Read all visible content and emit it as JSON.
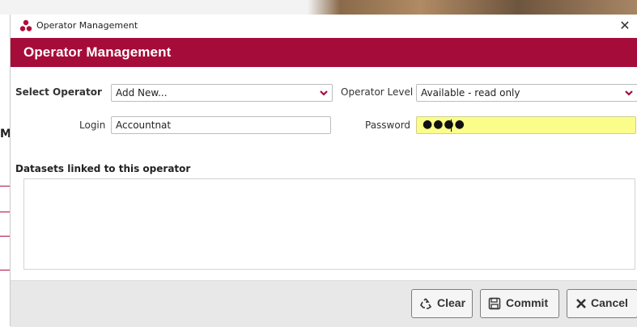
{
  "window": {
    "title": "Operator Management",
    "close_glyph": "✕"
  },
  "header": {
    "title": "Operator Management"
  },
  "form": {
    "select_operator": {
      "label": "Select Operator",
      "value": "Add New..."
    },
    "operator_level": {
      "label": "Operator Level",
      "value": "Available - read only"
    },
    "login": {
      "label": "Login",
      "value": "Accountnat"
    },
    "password": {
      "label": "Password",
      "masked_value": "●●●●"
    }
  },
  "datasets": {
    "label": "Datasets linked to this operator",
    "items": []
  },
  "footer": {
    "clear_label": "Clear",
    "commit_label": "Commit",
    "cancel_label": "Cancel"
  },
  "colors": {
    "brand": "#a60c3a",
    "password_highlight": "#fbfd8a",
    "footer_bg": "#e8e8e8"
  },
  "icons": {
    "app": "operator-group-icon",
    "clear": "recycle-icon",
    "commit": "save-icon",
    "cancel": "x-icon",
    "dropdown": "chevron-down-icon"
  }
}
